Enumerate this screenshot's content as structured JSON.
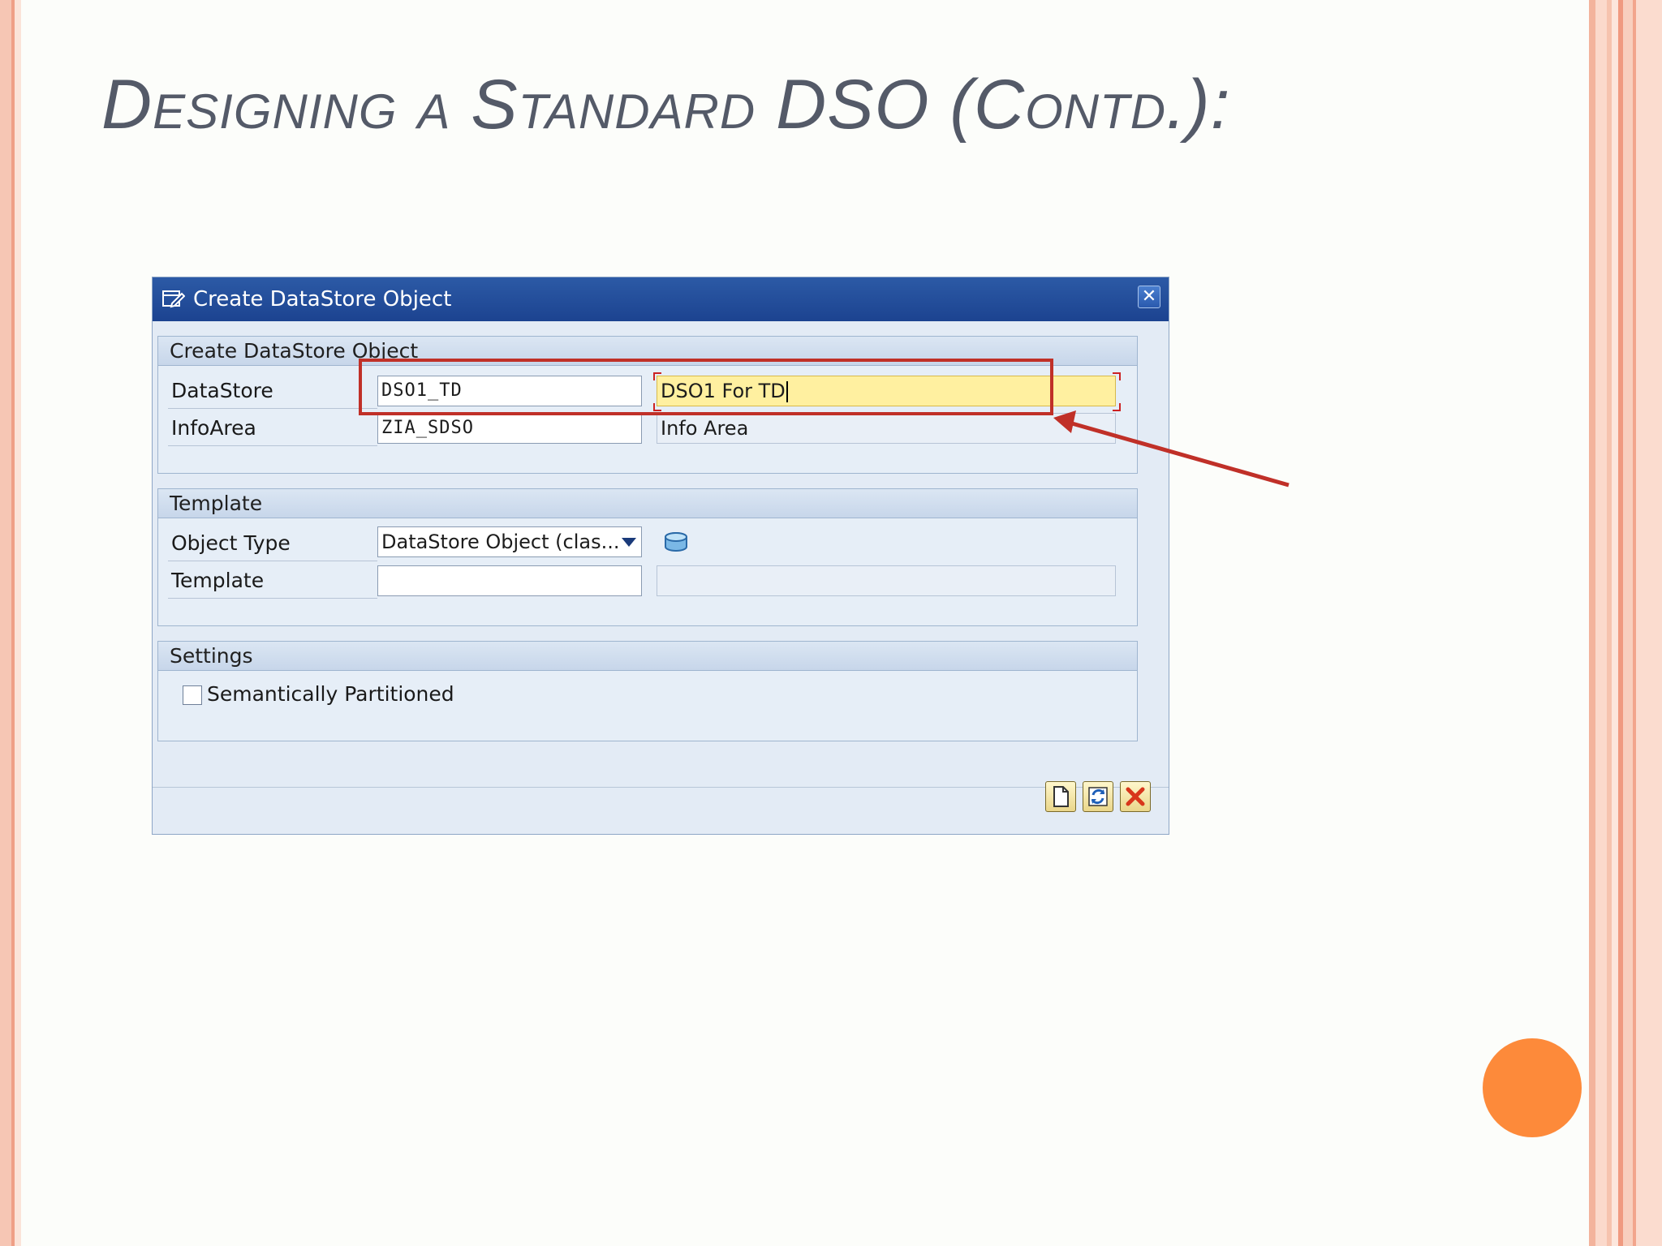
{
  "slide": {
    "title": "Designing a Standard DSO (Contd.):"
  },
  "dialog": {
    "title": "Create DataStore Object",
    "groups": {
      "create": {
        "header": "Create DataStore Object",
        "datastore_label": "DataStore",
        "datastore_value": "DSO1_TD",
        "datastore_description": "DSO1 For TD",
        "infoarea_label": "InfoArea",
        "infoarea_value": "ZIA_SDSO",
        "infoarea_description": "Info Area"
      },
      "template": {
        "header": "Template",
        "object_type_label": "Object Type",
        "object_type_value": "DataStore Object (clas...",
        "template_label": "Template",
        "template_value": "",
        "template_description": ""
      },
      "settings": {
        "header": "Settings",
        "semantic_label": "Semantically Partitioned",
        "semantic_checked": false
      }
    }
  },
  "colors": {
    "title_text": "#545a68",
    "dialog_titlebar": "#1c4390",
    "annotation_red": "#c03028",
    "focused_field": "#fff0a0",
    "orange_dot": "#fd8a3a"
  },
  "icons": {
    "titlebar": "dialog-edit-icon",
    "close": "close-icon",
    "object_type_info": "cylinder-icon",
    "buttons": [
      "new-document-icon",
      "refresh-icon",
      "cancel-icon"
    ]
  }
}
